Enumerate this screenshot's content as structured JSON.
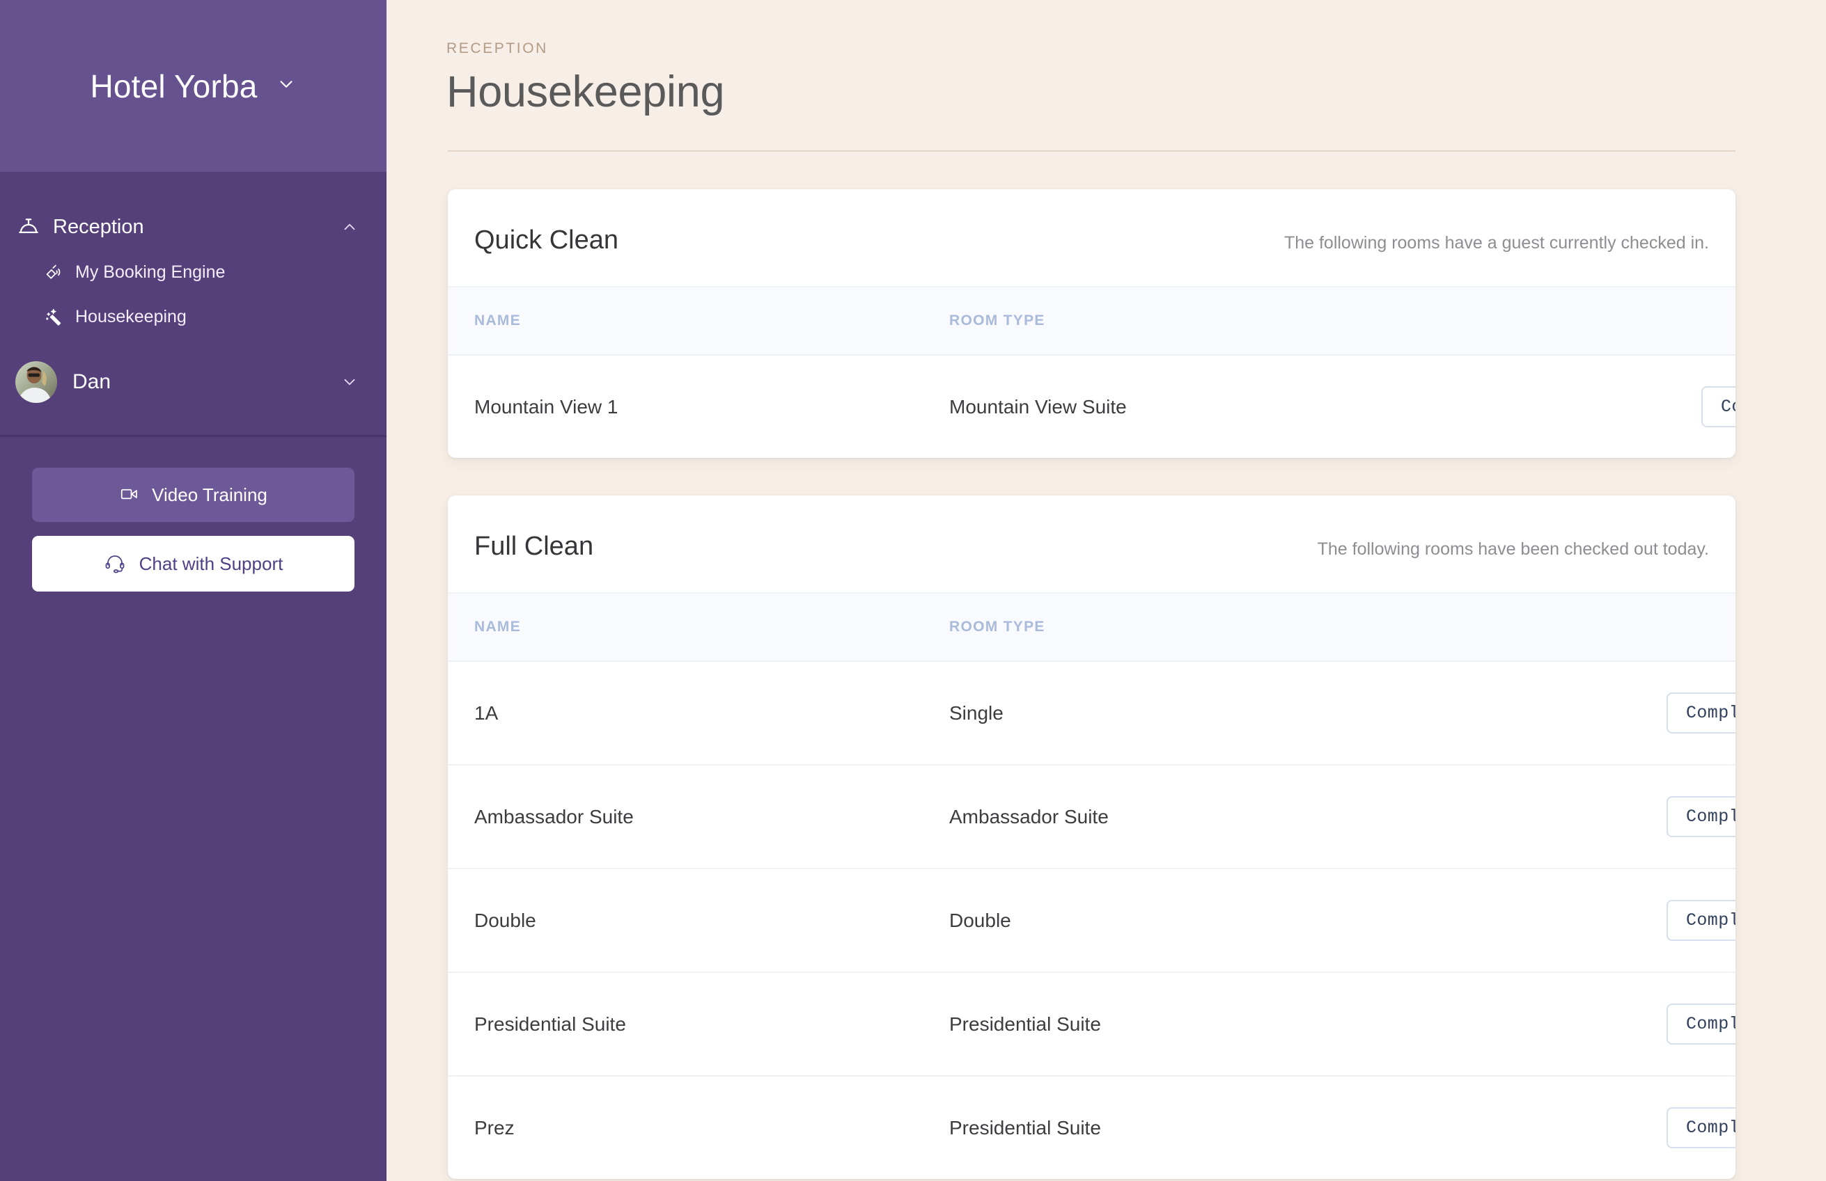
{
  "sidebar": {
    "brand": {
      "name": "Hotel Yorba",
      "chevron_icon": "chevron-down-icon"
    },
    "nav_group": {
      "label": "Reception",
      "icon": "service-bell-icon",
      "caret_icon": "chevron-up-icon"
    },
    "nav_items": [
      {
        "label": "My Booking Engine",
        "icon": "satellite-dish-icon"
      },
      {
        "label": "Housekeeping",
        "icon": "magic-wand-icon"
      }
    ],
    "user": {
      "name": "Dan",
      "caret_icon": "chevron-down-icon",
      "avatar_icon": "user-avatar-photo"
    },
    "actions": [
      {
        "label": "Video Training",
        "icon": "video-camera-icon",
        "style": "filled"
      },
      {
        "label": "Chat with Support",
        "icon": "headset-icon",
        "style": "white"
      }
    ]
  },
  "header": {
    "eyebrow": "RECEPTION",
    "title": "Housekeeping"
  },
  "cards": [
    {
      "title": "Quick Clean",
      "subtitle": "The following rooms have a guest currently checked in.",
      "columns": {
        "name": "NAME",
        "room_type": "ROOM TYPE"
      },
      "action_label": "Complete",
      "rows": [
        {
          "name": "Mountain View 1",
          "room_type": "Mountain View Suite",
          "action": "Complete"
        }
      ]
    },
    {
      "title": "Full Clean",
      "subtitle": "The following rooms have been checked out today.",
      "columns": {
        "name": "NAME",
        "room_type": "ROOM TYPE"
      },
      "action_label": "Complete",
      "rows": [
        {
          "name": "1A",
          "room_type": "Single",
          "action": "Complete"
        },
        {
          "name": "Ambassador Suite",
          "room_type": "Ambassador Suite",
          "action": "Complete"
        },
        {
          "name": "Double",
          "room_type": "Double",
          "action": "Complete"
        },
        {
          "name": "Presidential Suite",
          "room_type": "Presidential Suite",
          "action": "Complete"
        },
        {
          "name": "Prez",
          "room_type": "Presidential Suite",
          "action": "Complete"
        }
      ]
    }
  ],
  "colors": {
    "brand_purple_top": "#66528f",
    "sidebar_purple": "#56407a",
    "page_bg": "#f6eee7",
    "card_bg": "#ffffff",
    "accent_text": "#4e3f86",
    "table_header_text": "#a9bada",
    "eyebrow": "#b39b86"
  }
}
